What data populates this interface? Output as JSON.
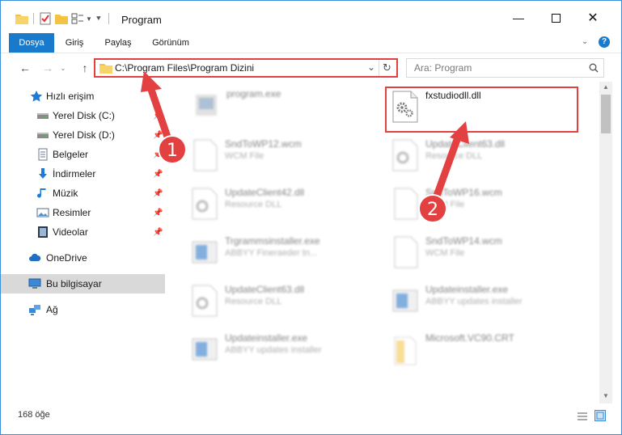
{
  "window": {
    "title": "Program"
  },
  "ribbon": {
    "tabs": [
      "Dosya",
      "Giriş",
      "Paylaş",
      "Görünüm"
    ]
  },
  "address": {
    "path": "C:\\Program Files\\Program Dizini"
  },
  "search": {
    "placeholder": "Ara: Program"
  },
  "sidebar": {
    "quick_access": "Hızlı erişim",
    "items": [
      {
        "label": "Yerel Disk (C:)",
        "icon": "hard-drive-icon"
      },
      {
        "label": "Yerel Disk (D:)",
        "icon": "hard-drive-icon"
      },
      {
        "label": "Belgeler",
        "icon": "documents-icon"
      },
      {
        "label": "İndirmeler",
        "icon": "download-icon"
      },
      {
        "label": "Müzik",
        "icon": "music-icon"
      },
      {
        "label": "Resimler",
        "icon": "pictures-icon"
      },
      {
        "label": "Videolar",
        "icon": "video-icon"
      }
    ],
    "onedrive": "OneDrive",
    "this_pc": "Bu bilgisayar",
    "network": "Ağ"
  },
  "files": [
    {
      "name": "program.exe",
      "type": ""
    },
    {
      "name": "fxstudiodll.dll",
      "type": ""
    },
    {
      "name": "SndToWP12.wcm",
      "type": "WCM File"
    },
    {
      "name": "UpdateClient63.dll",
      "type": "Resource DLL"
    },
    {
      "name": "UpdateClient42.dll",
      "type": "Resource DLL"
    },
    {
      "name": "SndToWP16.wcm",
      "type": "WCM File"
    },
    {
      "name": "Trgrammsinstaller.exe",
      "type": "ABBYY Fineraeder tn..."
    },
    {
      "name": "SndToWP14.wcm",
      "type": "WCM File"
    },
    {
      "name": "UpdateClient63.dll",
      "type": "Resource DLL"
    },
    {
      "name": "Updateinstaller.exe",
      "type": "ABBYY updates installer"
    },
    {
      "name": "Updateinstaller.exe",
      "type": "ABBYY updates installer"
    },
    {
      "name": "Microsoft.VC90.CRT",
      "type": ""
    }
  ],
  "status": {
    "count": "168 öğe"
  },
  "annotations": {
    "badge1": "1",
    "badge2": "2"
  },
  "colors": {
    "accent": "#1979ca",
    "highlight": "#e34141",
    "folder": "#f3c443"
  }
}
